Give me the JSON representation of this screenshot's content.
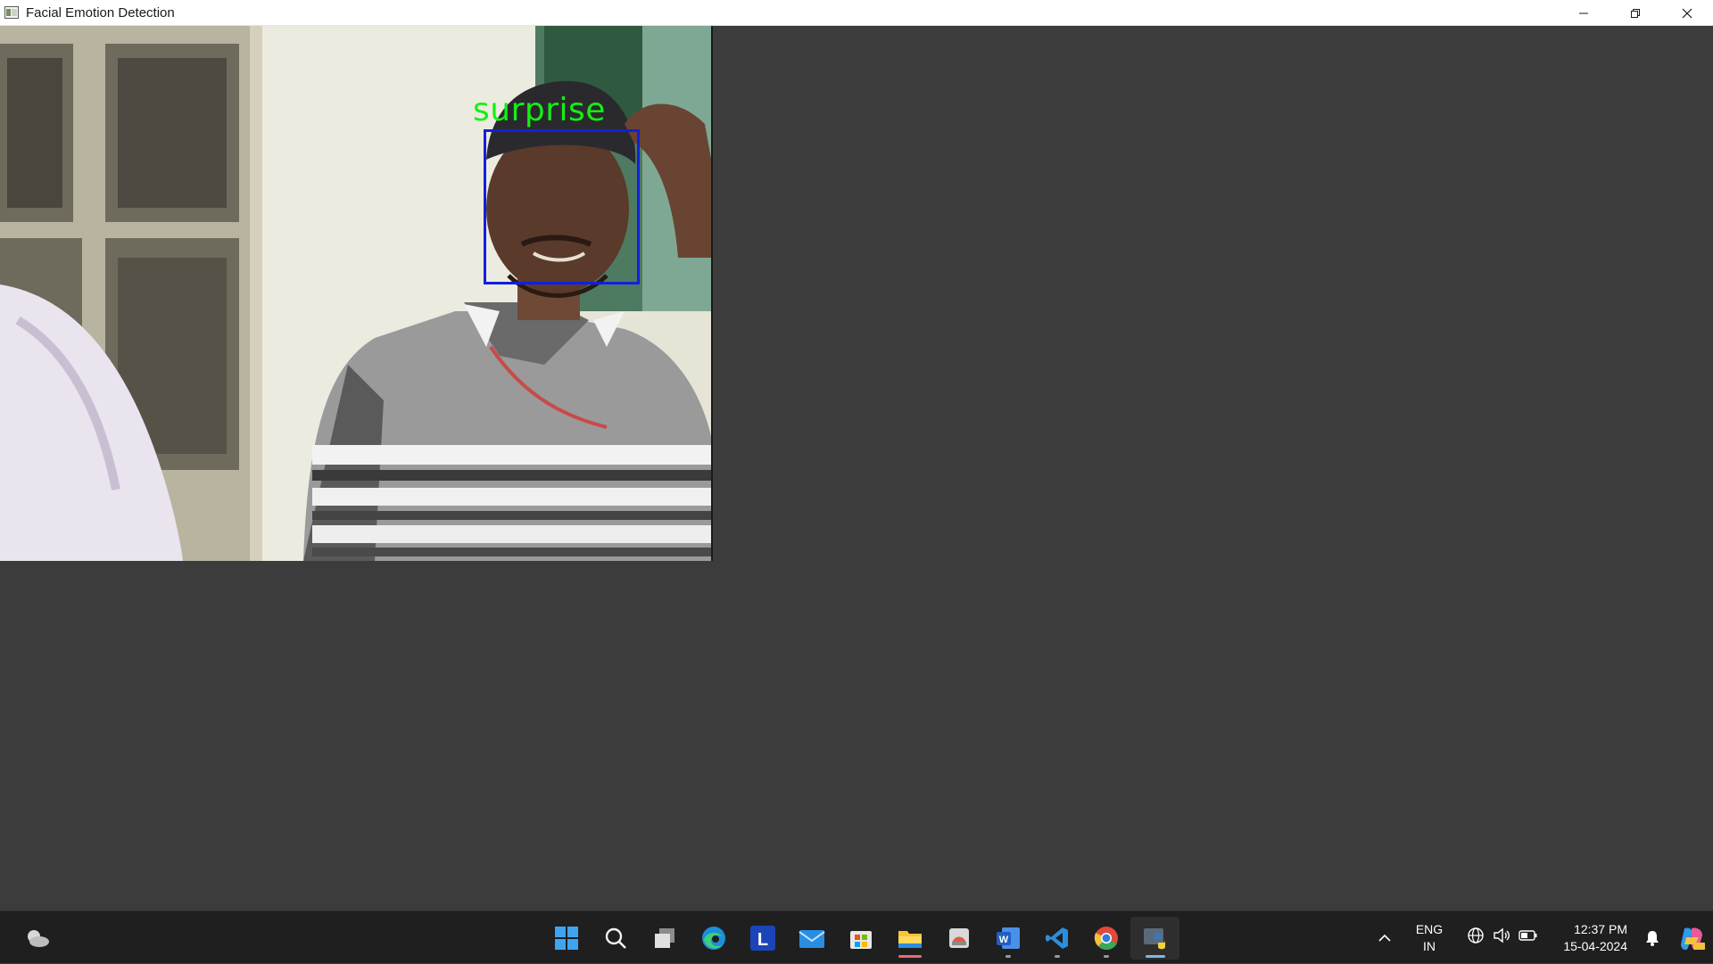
{
  "window": {
    "title": "Facial Emotion Detection"
  },
  "detection": {
    "emotion_label": "surprise",
    "label_color": "#14f014",
    "box_color": "#1020e0"
  },
  "taskbar": {
    "pinned": [
      "start",
      "search",
      "task-view",
      "edge",
      "launcher-L",
      "mail",
      "store",
      "file-explorer",
      "photos",
      "word",
      "vscode",
      "chrome",
      "python"
    ],
    "launcher_letter": "L",
    "word_letter": "W",
    "language": {
      "line1": "ENG",
      "line2": "IN"
    },
    "clock": {
      "time": "12:37 PM",
      "date": "15-04-2024"
    }
  },
  "colors": {
    "client_bg": "#3c3c3c",
    "taskbar_bg": "#1f1f1f"
  }
}
